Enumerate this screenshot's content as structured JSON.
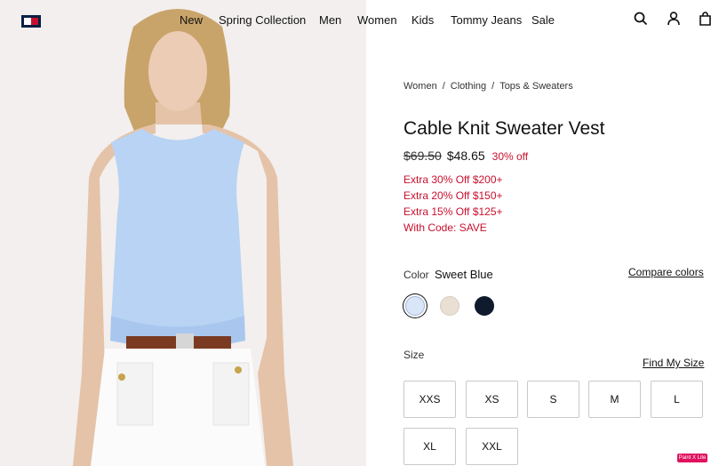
{
  "header": {
    "nav": [
      "New",
      "Spring Collection",
      "Men",
      "Women",
      "Kids",
      "Tommy Jeans",
      "Sale"
    ],
    "icons": [
      "search-icon",
      "account-icon",
      "bag-icon"
    ]
  },
  "breadcrumb": [
    "Women",
    "Clothing",
    "Tops & Sweaters"
  ],
  "product": {
    "title": "Cable Knit Sweater Vest",
    "price_old": "$69.50",
    "price_new": "$48.65",
    "discount": "30% off",
    "promos": [
      "Extra 30% Off $200+",
      "Extra 20% Off $150+",
      "Extra 15% Off $125+",
      "With Code: SAVE"
    ],
    "color_label": "Color",
    "color_value": "Sweet Blue",
    "compare_label": "Compare colors",
    "swatches": [
      {
        "name": "Sweet Blue",
        "color": "#d9e6f7",
        "selected": true
      },
      {
        "name": "Beige",
        "color": "#e9e0d3",
        "selected": false
      },
      {
        "name": "Navy",
        "color": "#0f1a2c",
        "selected": false
      }
    ],
    "size_label": "Size",
    "find_size_label": "Find My Size",
    "sizes": [
      "XXS",
      "XS",
      "S",
      "M",
      "L",
      "XL",
      "XXL"
    ]
  },
  "badge": "Paint X Lite",
  "colors": {
    "accent_red": "#c8102e",
    "brand_navy": "#0a1f44"
  }
}
